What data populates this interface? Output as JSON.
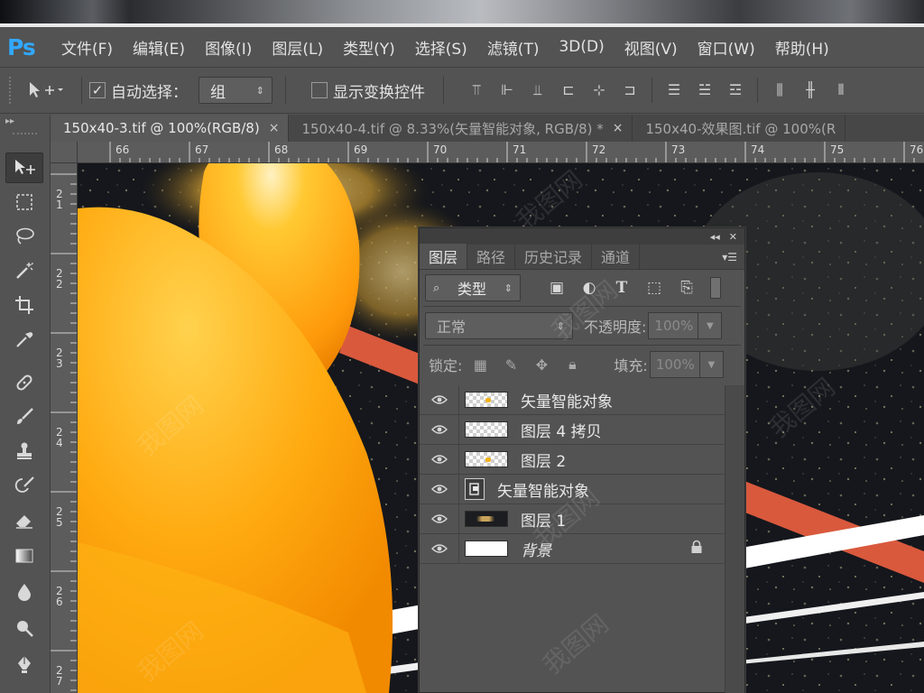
{
  "app": {
    "logo": "Ps"
  },
  "menu": [
    "文件(F)",
    "编辑(E)",
    "图像(I)",
    "图层(L)",
    "类型(Y)",
    "选择(S)",
    "滤镜(T)",
    "3D(D)",
    "视图(V)",
    "窗口(W)",
    "帮助(H)"
  ],
  "options": {
    "auto_select_label": "自动选择：",
    "auto_select_checked": true,
    "auto_select_value": "组",
    "show_transform_label": "显示变换控件",
    "show_transform_checked": false
  },
  "tabs": [
    {
      "label": "150x40-3.tif @ 100%(RGB/8)",
      "close": "×",
      "active": true
    },
    {
      "label": "150x40-4.tif @ 8.33%(矢量智能对象, RGB/8) *",
      "close": "×",
      "active": false
    },
    {
      "label": "150x40-效果图.tif @ 100%(R",
      "close": "",
      "active": false
    }
  ],
  "ruler_h": [
    "66",
    "67",
    "68",
    "69",
    "70",
    "71",
    "72",
    "73",
    "74",
    "75",
    "76"
  ],
  "ruler_v": [
    [
      "2",
      "1"
    ],
    [
      "2",
      "2"
    ],
    [
      "2",
      "3"
    ],
    [
      "2",
      "4"
    ],
    [
      "2",
      "5"
    ],
    [
      "2",
      "6"
    ],
    [
      "2",
      "7"
    ]
  ],
  "layers_panel": {
    "tabs": [
      "图层",
      "路径",
      "历史记录",
      "通道"
    ],
    "filter_label": "类型",
    "blend_mode": "正常",
    "opacity_label": "不透明度:",
    "opacity_value": "100%",
    "lock_label": "锁定:",
    "fill_label": "填充:",
    "fill_value": "100%",
    "layers": [
      {
        "name": "矢量智能对象",
        "thumb": "checker-dot"
      },
      {
        "name": "图层 4 拷贝",
        "thumb": "checker"
      },
      {
        "name": "图层 2",
        "thumb": "checker-dot"
      },
      {
        "name": "矢量智能对象",
        "thumb": "smart-object-icon"
      },
      {
        "name": "图层 1",
        "thumb": "dark"
      },
      {
        "name": "背景",
        "thumb": "white",
        "locked": true
      }
    ]
  },
  "watermark": "我图网",
  "colors": {
    "ps_blue": "#31a8ff",
    "orange": "#ffb010",
    "stripe_red": "#d9593d"
  }
}
